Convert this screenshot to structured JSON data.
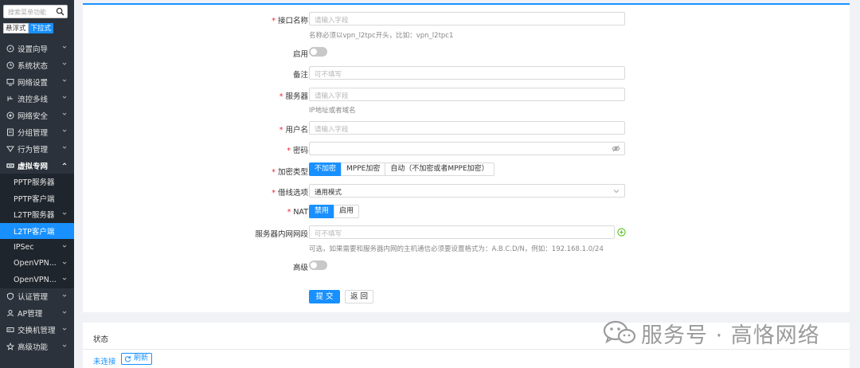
{
  "sidebar": {
    "search_placeholder": "搜索菜单功能",
    "mode_float": "悬浮式",
    "mode_dropdown": "下拉式",
    "items": [
      {
        "label": "设置向导",
        "icon": "compass-icon"
      },
      {
        "label": "系统状态",
        "icon": "clock-icon"
      },
      {
        "label": "网络设置",
        "icon": "monitor-icon"
      },
      {
        "label": "流控多线",
        "icon": "flow-icon"
      },
      {
        "label": "网络安全",
        "icon": "shield-icon"
      },
      {
        "label": "分组管理",
        "icon": "list-icon"
      },
      {
        "label": "行为管理",
        "icon": "filter-icon"
      },
      {
        "label": "虚拟专网",
        "icon": "vpn-icon"
      }
    ],
    "sub_items": [
      {
        "label": "PPTP服务器"
      },
      {
        "label": "PPTP客户端"
      },
      {
        "label": "L2TP服务器"
      },
      {
        "label": "L2TP客户端"
      },
      {
        "label": "IPSec"
      },
      {
        "label": "OpenVPN..."
      },
      {
        "label": "OpenVPN..."
      }
    ],
    "bottom_items": [
      {
        "label": "认证管理",
        "icon": "check-shield-icon"
      },
      {
        "label": "AP管理",
        "icon": "person-icon"
      },
      {
        "label": "交换机管理",
        "icon": "switch-icon"
      },
      {
        "label": "高级功能",
        "icon": "star-icon"
      }
    ]
  },
  "form": {
    "iface_name_label": "接口名称",
    "iface_name_placeholder": "请输入字段",
    "iface_name_hint": "名称必须以vpn_l2tpc开头，比如：vpn_l2tpc1",
    "enable_label": "启用",
    "remark_label": "备注",
    "remark_placeholder": "可不填写",
    "server_label": "服务器",
    "server_placeholder": "请输入字段",
    "server_hint": "IP地址或者域名",
    "username_label": "用户名",
    "username_placeholder": "请输入字段",
    "password_label": "密码",
    "encrypt_label": "加密类型",
    "encrypt_options": [
      "不加密",
      "MPPE加密",
      "自动（不加密或者MPPE加密）"
    ],
    "line_label": "借线选项",
    "line_value": "通用模式",
    "nat_label": "NAT",
    "nat_options": [
      "禁用",
      "启用"
    ],
    "lan_label": "服务器内网网段",
    "lan_placeholder": "可不填写",
    "lan_hint": "可选，如果需要和服务器内网的主机通信必须要设置格式为：A.B.C.D/N，例如：192.168.1.0/24",
    "advanced_label": "高级",
    "submit_label": "提交",
    "back_label": "返回"
  },
  "status": {
    "title": "状态",
    "state_text": "未连接",
    "refresh_label": "刷新"
  },
  "watermark": {
    "text": "服务号 · 高恪网络"
  },
  "colors": {
    "accent": "#1890ff",
    "sidebar_bg": "#2b323b",
    "required": "#e23"
  }
}
